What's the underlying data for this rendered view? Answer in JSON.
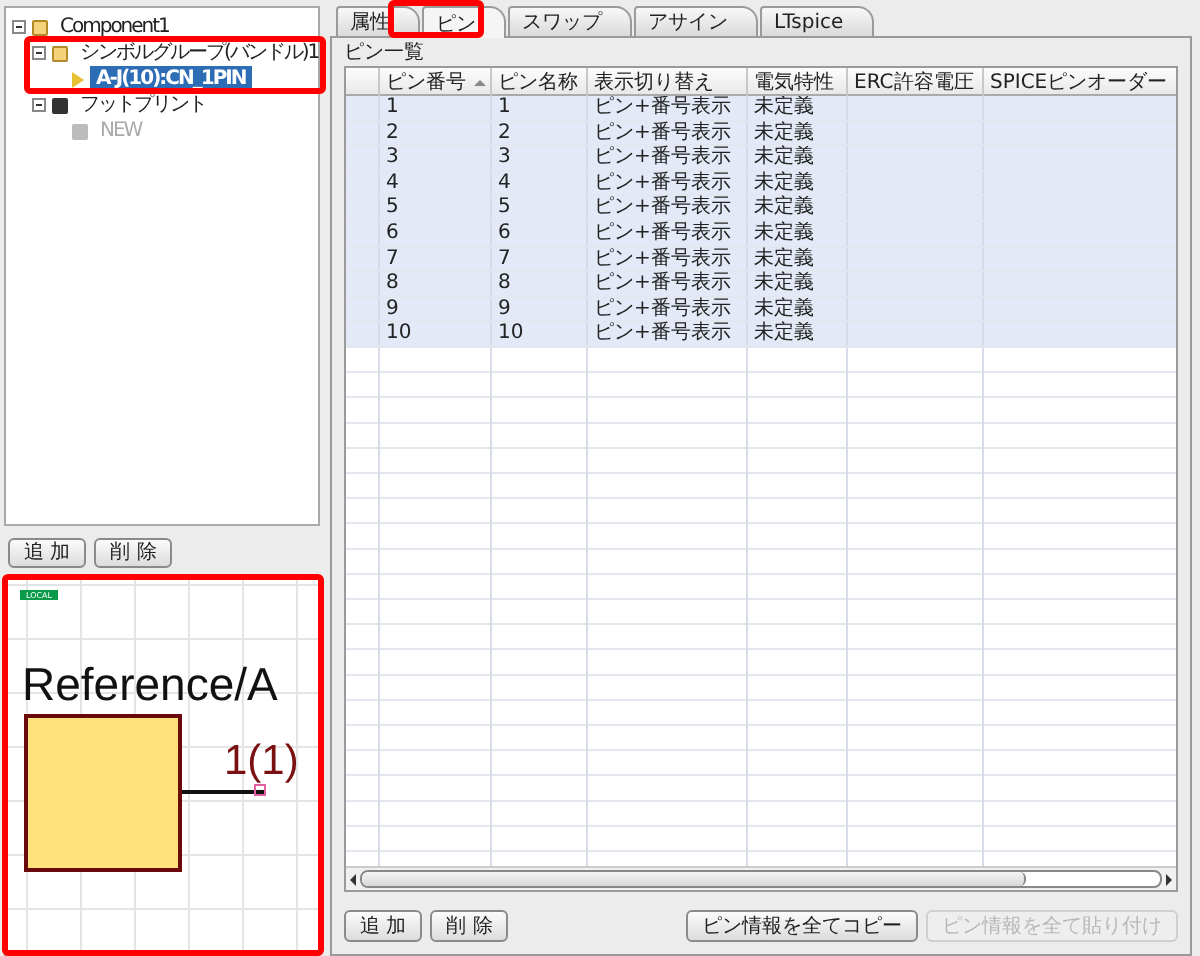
{
  "tree": {
    "nodes": [
      {
        "label": "Component1",
        "kind": "component",
        "expanded": true,
        "selected": false,
        "children": [
          {
            "label": "シンボルグループ(バンドル)1",
            "kind": "group",
            "expanded": true,
            "selected": false,
            "children": [
              {
                "label": "A-J(10):CN_1PIN",
                "kind": "symbol",
                "selected": true
              }
            ]
          },
          {
            "label": "フットプリント",
            "kind": "footprint",
            "expanded": true,
            "selected": false,
            "children": [
              {
                "label": "NEW",
                "kind": "new",
                "selected": false
              }
            ]
          }
        ]
      }
    ]
  },
  "tree_buttons": [
    {
      "label": "追 加"
    },
    {
      "label": "削 除"
    }
  ],
  "preview": {
    "badge": "LOCAL",
    "reference": "Reference/A",
    "pin_label": "1(1)"
  },
  "tabs": [
    {
      "label": "属性",
      "selected": false
    },
    {
      "label": "ピン",
      "selected": true
    },
    {
      "label": "スワップ",
      "selected": false
    },
    {
      "label": "アサイン",
      "selected": false
    },
    {
      "label": "LTspice",
      "selected": false
    }
  ],
  "pin_list": {
    "title": "ピン一覧",
    "columns": [
      {
        "label": "ピン番号",
        "sorted": true
      },
      {
        "label": "ピン名称",
        "sorted": false
      },
      {
        "label": "表示切り替え",
        "sorted": false
      },
      {
        "label": "電気特性",
        "sorted": false
      },
      {
        "label": "ERC許容電圧",
        "sorted": false
      },
      {
        "label": "SPICEピンオーダー",
        "sorted": false
      }
    ],
    "rows": [
      {
        "cells": [
          "1",
          "1",
          "ピン+番号表示",
          "未定義"
        ],
        "selected": true
      },
      {
        "cells": [
          "2",
          "2",
          "ピン+番号表示",
          "未定義"
        ],
        "selected": true
      },
      {
        "cells": [
          "3",
          "3",
          "ピン+番号表示",
          "未定義"
        ],
        "selected": true
      },
      {
        "cells": [
          "4",
          "4",
          "ピン+番号表示",
          "未定義"
        ],
        "selected": true
      },
      {
        "cells": [
          "5",
          "5",
          "ピン+番号表示",
          "未定義"
        ],
        "selected": true
      },
      {
        "cells": [
          "6",
          "6",
          "ピン+番号表示",
          "未定義"
        ],
        "selected": true
      },
      {
        "cells": [
          "7",
          "7",
          "ピン+番号表示",
          "未定義"
        ],
        "selected": true
      },
      {
        "cells": [
          "8",
          "8",
          "ピン+番号表示",
          "未定義"
        ],
        "selected": true
      },
      {
        "cells": [
          "9",
          "9",
          "ピン+番号表示",
          "未定義"
        ],
        "selected": true
      },
      {
        "cells": [
          "10",
          "10",
          "ピン+番号表示",
          "未定義"
        ],
        "selected": true
      }
    ],
    "buttons": [
      {
        "label": "追 加",
        "disabled": false
      },
      {
        "label": "削 除",
        "disabled": false
      },
      {
        "label": "ピン情報を全てコピー",
        "disabled": false
      },
      {
        "label": "ピン情報を全て貼り付け",
        "disabled": true
      }
    ]
  }
}
